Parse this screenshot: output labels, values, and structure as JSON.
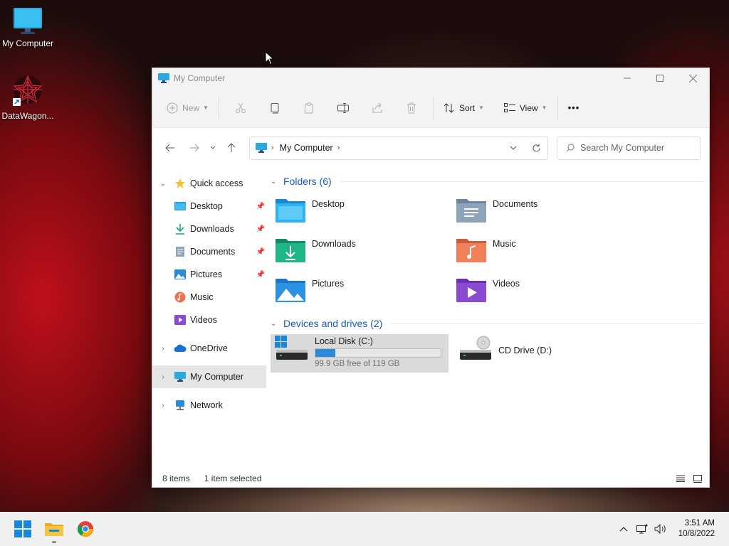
{
  "desktop": {
    "icons": [
      {
        "label": "My Computer",
        "icon": "monitor-icon"
      },
      {
        "label": "DataWagon...",
        "icon": "datawagon-app-icon"
      }
    ]
  },
  "window": {
    "title": "My Computer",
    "controls": [
      "minimize",
      "maximize",
      "close"
    ]
  },
  "toolbar": {
    "new_label": "New",
    "sort_label": "Sort",
    "view_label": "View",
    "more_label": "•••"
  },
  "address": {
    "crumb": "My Computer",
    "search_placeholder": "Search My Computer"
  },
  "sidebar": {
    "quick_access": "Quick access",
    "items": [
      {
        "label": "Desktop"
      },
      {
        "label": "Downloads"
      },
      {
        "label": "Documents"
      },
      {
        "label": "Pictures"
      },
      {
        "label": "Music"
      },
      {
        "label": "Videos"
      }
    ],
    "onedrive": "OneDrive",
    "my_computer": "My Computer",
    "network": "Network"
  },
  "content": {
    "folders_header": "Folders (6)",
    "folders": [
      {
        "name": "Desktop",
        "icon": "desktop-folder-icon"
      },
      {
        "name": "Documents",
        "icon": "documents-folder-icon"
      },
      {
        "name": "Downloads",
        "icon": "downloads-folder-icon"
      },
      {
        "name": "Music",
        "icon": "music-folder-icon"
      },
      {
        "name": "Pictures",
        "icon": "pictures-folder-icon"
      },
      {
        "name": "Videos",
        "icon": "videos-folder-icon"
      }
    ],
    "drives_header": "Devices and drives (2)",
    "drives": [
      {
        "name": "Local Disk (C:)",
        "free_text": "99.9 GB free of 119 GB",
        "used_fraction": 0.16
      },
      {
        "name": "CD Drive (D:)"
      }
    ]
  },
  "status": {
    "items": "8 items",
    "selected": "1 item selected"
  },
  "taskbar": {
    "apps": [
      "start-icon",
      "file-explorer-icon",
      "chrome-icon"
    ],
    "time": "3:51 AM",
    "date": "10/8/2022"
  },
  "colors": {
    "accent": "#1c5bbd",
    "progress": "#2a8ad7"
  }
}
